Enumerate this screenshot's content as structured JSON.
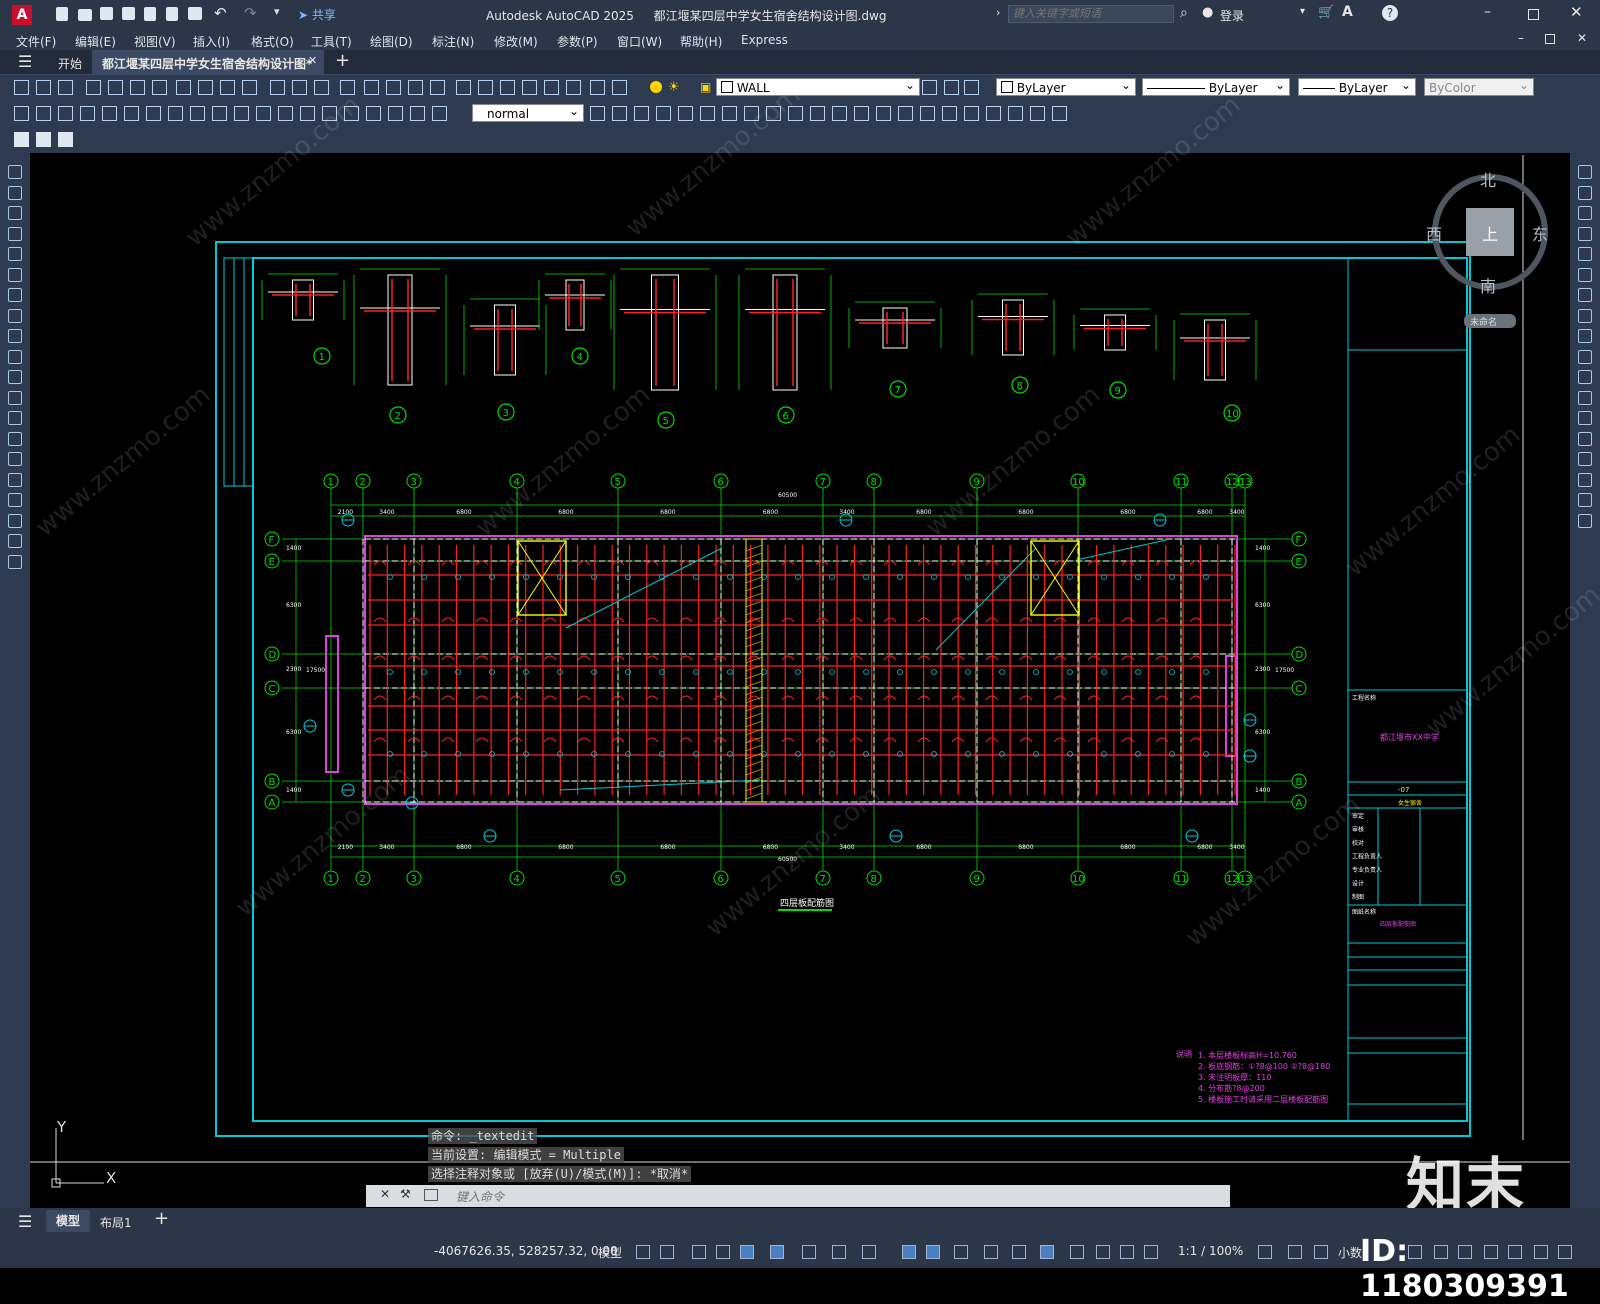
{
  "app": {
    "logo": "A",
    "title": "Autodesk AutoCAD 2025",
    "document": "都江堰某四层中学女生宿舍结构设计图.dwg",
    "share_label": "共享",
    "search_placeholder": "键入关键字或短语",
    "login_label": "登录",
    "help_label": "?"
  },
  "menu": [
    "文件(F)",
    "编辑(E)",
    "视图(V)",
    "插入(I)",
    "格式(O)",
    "工具(T)",
    "绘图(D)",
    "标注(N)",
    "修改(M)",
    "参数(P)",
    "窗口(W)",
    "帮助(H)",
    "Express"
  ],
  "tabs": {
    "start": "开始",
    "active": "都江堰某四层中学女生宿舍结构设计图*",
    "add": "+"
  },
  "toolbar": {
    "layer": "WALL",
    "color": "ByLayer",
    "linetype": "ByLayer",
    "lineweight": "ByLayer",
    "plotstyle": "ByColor",
    "textstyle": "normal"
  },
  "viewcube": {
    "north": "北",
    "south": "南",
    "east": "东",
    "west": "西",
    "top": "上",
    "wcs": "未命名"
  },
  "drawing": {
    "plan_title": "四层板配筋图",
    "total_dim": "60500",
    "axes_top": [
      "1",
      "2",
      "3",
      "4",
      "5",
      "6",
      "7",
      "8",
      "9",
      "10",
      "11",
      "12",
      "13"
    ],
    "axes_side": [
      "F",
      "E",
      "D",
      "C",
      "B",
      "A"
    ],
    "dims_top": [
      "2100",
      "3400",
      "6800",
      "6800",
      "6800",
      "6800",
      "3400",
      "6800",
      "6800",
      "6800",
      "6800",
      "3400",
      "600"
    ],
    "dims_side": [
      "1400",
      "6300",
      "2300",
      "6300",
      "1400",
      "17500"
    ],
    "detail_numbers": [
      "1",
      "2",
      "3",
      "4",
      "5",
      "6",
      "7",
      "8",
      "9",
      "10"
    ],
    "notes_title": "说明",
    "notes": [
      "1. 本层楼板标高H=10.760",
      "2. 板底钢筋：①?8@100  ②?8@180",
      "3. 未注明板厚：110",
      "4. 分布筋?8@200",
      "5. 楼板施工时请采用二层楼板配筋图"
    ],
    "titleblock": {
      "project_label": "工程名称",
      "project": "都江堰市XX中学",
      "number": "-07",
      "subitem": "女生宿舍",
      "sheet_label": "图纸名称",
      "sheet": "四层板配筋图",
      "rows": [
        "审定",
        "审核",
        "校对",
        "工程负责人",
        "专业负责人",
        "设计",
        "制图"
      ]
    }
  },
  "ucs": {
    "y": "Y",
    "x": "X"
  },
  "command": {
    "lines": [
      "命令: _textedit",
      "当前设置: 编辑模式 = Multiple",
      "选择注释对象或 [放弃(U)/模式(M)]: *取消*"
    ],
    "placeholder": "键入命令"
  },
  "layout_tabs": [
    "模型",
    "布局1",
    "+"
  ],
  "status": {
    "coords": "-4067626.35, 528257.32, 0.00",
    "space": "模型",
    "scale": "1:1 / 100%",
    "units": "小数"
  },
  "watermark": {
    "brand": "知末",
    "id": "ID: 1180309391",
    "site": "www.znzmo.com"
  },
  "colors": {
    "frame": "#00c8d8",
    "axis": "#00e000",
    "rebar": "#ff2020",
    "beam": "#e040e0",
    "stair": "#ffff00",
    "chrome": "#2b3648"
  }
}
